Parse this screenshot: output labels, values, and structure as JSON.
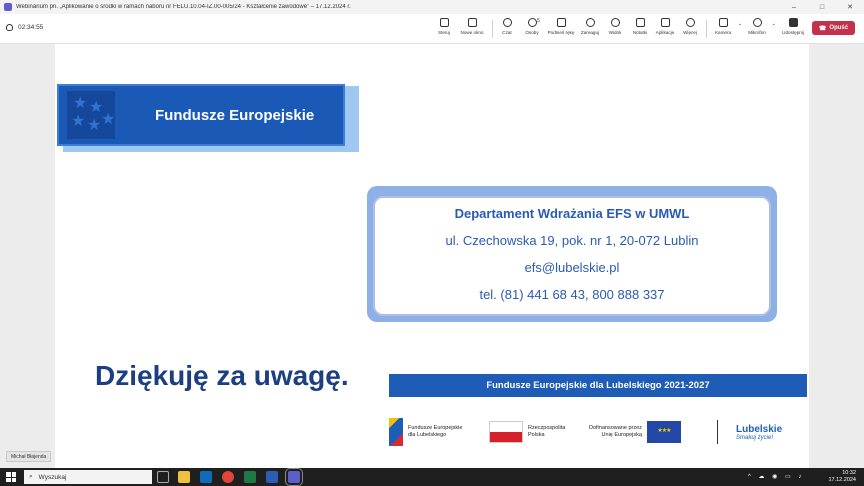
{
  "window": {
    "title": "Webinarium pn. „Aplikowanie o środki w ramach naboru nr FELU.10.04-IZ.00-005/24 - Kształcenie zawodowe” – 17.12.2024 r.",
    "controls": [
      "–",
      "□",
      "✕"
    ]
  },
  "toolbar": {
    "timer": "02:34:55",
    "buttons": [
      {
        "label": "Steruj",
        "icon": "control-icon"
      },
      {
        "label": "Nowe okno",
        "icon": "new-window-icon"
      },
      {
        "label": "Czat",
        "icon": "chat-icon"
      },
      {
        "label": "Osoby",
        "icon": "people-icon",
        "count": "5"
      },
      {
        "label": "Podnieś rękę",
        "icon": "raise-hand-icon"
      },
      {
        "label": "Zareaguj",
        "icon": "react-icon"
      },
      {
        "label": "Widok",
        "icon": "view-icon"
      },
      {
        "label": "Notatki",
        "icon": "notes-icon"
      },
      {
        "label": "Aplikacje",
        "icon": "apps-icon"
      },
      {
        "label": "Więcej",
        "icon": "more-icon"
      },
      {
        "label": "Kamera",
        "icon": "camera-off-icon"
      },
      {
        "label": "Mikrofon",
        "icon": "mic-off-icon"
      },
      {
        "label": "Udostępnij",
        "icon": "share-icon"
      }
    ],
    "leave_label": "Opuść",
    "leave_color": "#c4314b"
  },
  "slide": {
    "logo_text": "Fundusze Europejskie",
    "contact": {
      "department": "Departament Wdrażania EFS w UMWL",
      "address": "ul. Czechowska 19, pok. nr 1, 20-072 Lublin",
      "email": "efs@lubelskie.pl",
      "phone": "tel. (81) 441 68 43, 800 888 337"
    },
    "thanks": "Dziękuję za uwagę.",
    "program_bar": "Fundusze Europejskie dla Lubelskiego 2021-2027",
    "logos": {
      "fe_line1": "Fundusze Europejskie",
      "fe_line2": "dla Lubelskiego",
      "rp_line1": "Rzeczpospolita",
      "rp_line2": "Polska",
      "eu_line1": "Dofinansowane przez",
      "eu_line2": "Unię Europejską",
      "lub_name": "Lubelskie",
      "lub_slogan": "Smakuj życie!"
    },
    "brand_color": "#1a59b6"
  },
  "participant_name": "Michał Błajenda",
  "taskbar": {
    "search_placeholder": "Wyszukaj",
    "time": "10:32",
    "date": "17.12.2024"
  }
}
